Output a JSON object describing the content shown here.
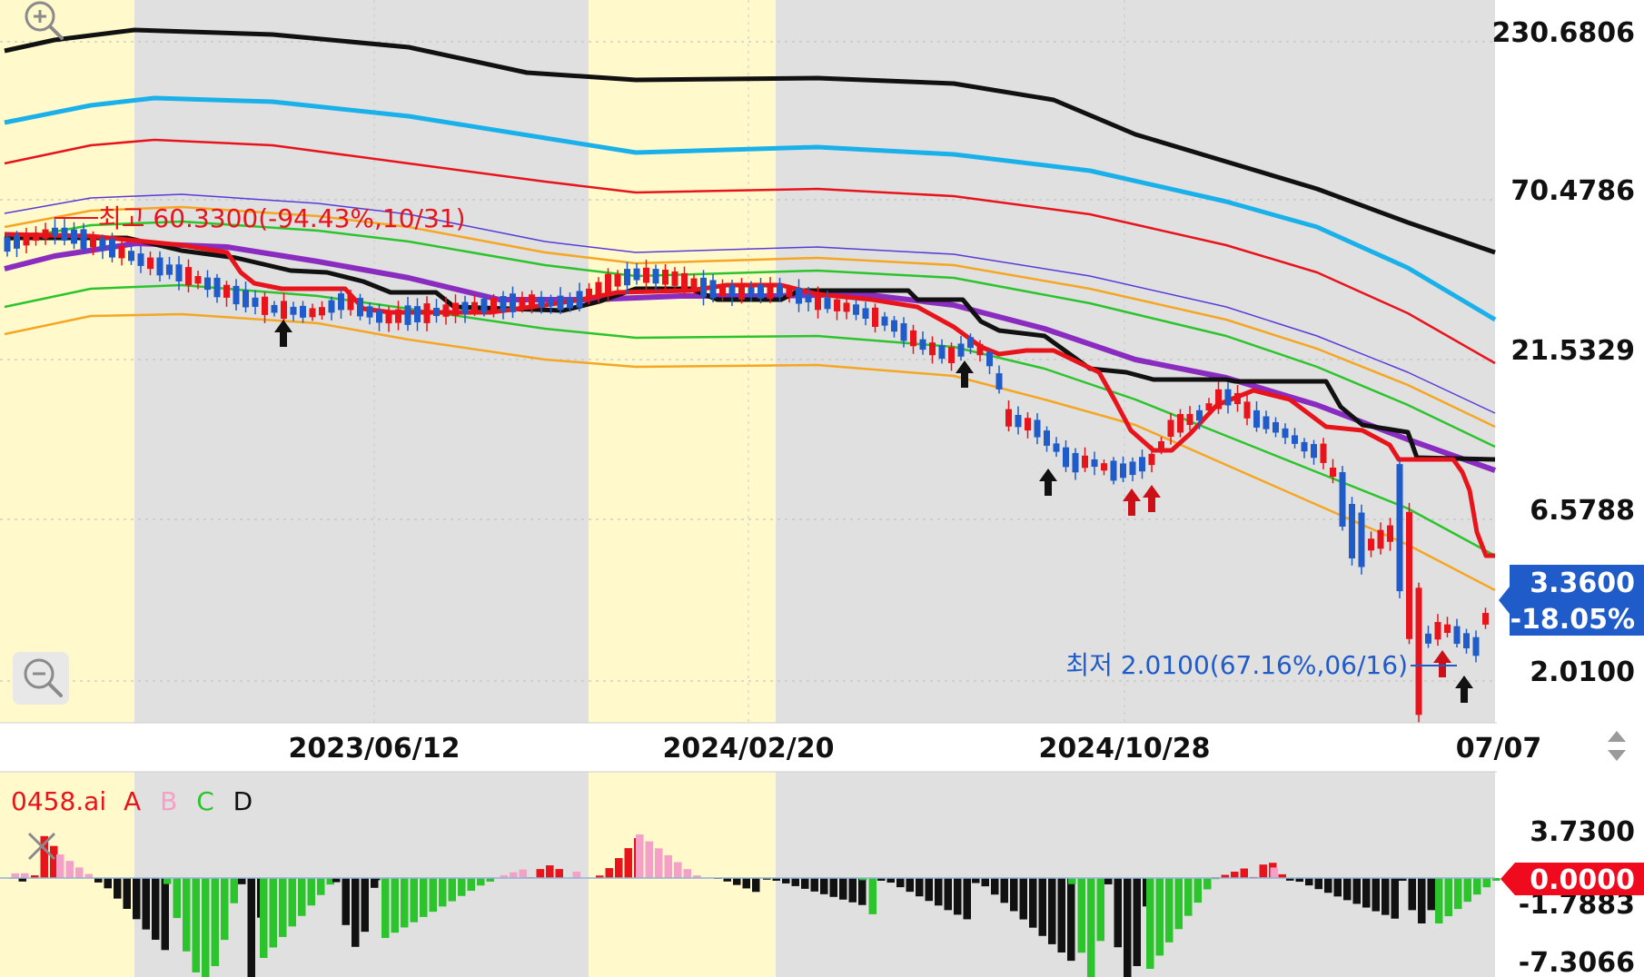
{
  "chart_data": [
    {
      "type": "candlestick",
      "scale": "log",
      "ylim": [
        1.7,
        300
      ],
      "y_ticks": [
        "230.6806",
        "70.4786",
        "21.5329",
        "6.5788",
        "2.0100"
      ],
      "x_ticks": [
        "2023/06/12",
        "2024/02/20",
        "2024/10/28",
        "07/07"
      ],
      "last_price": "3.3600",
      "last_change": "-18.05%",
      "annotations": {
        "high": "최고 60.3300(-94.43%,10/31)",
        "low": "최저 2.0100(67.16%,06/16)"
      },
      "colors": {
        "up": "#e8141c",
        "down": "#1f5cc9",
        "black_line": "#111111",
        "blue_line": "#1ab0ea",
        "red_line": "#e8141c",
        "purple_line": "#8a2cc0",
        "green_line": "#2cc42c",
        "orange_line": "#f5a623",
        "thin_purple": "#5a3ad8",
        "highlight": "#fff9cc",
        "shade": "#e0e0e0"
      }
    },
    {
      "type": "histogram",
      "label_prefix": "0458.ai",
      "legend": [
        {
          "name": "A",
          "color": "#e8141c"
        },
        {
          "name": "B",
          "color": "#f5a0c6"
        },
        {
          "name": "C",
          "color": "#2cc42c"
        },
        {
          "name": "D",
          "color": "#111111"
        }
      ],
      "y_ticks": [
        "3.7300",
        "0.0000",
        "-1.7883",
        "-7.3066"
      ],
      "current": "0.0000"
    }
  ],
  "icons": [
    "zoom-in-icon",
    "zoom-out-icon",
    "close-icon",
    "scroll-arrows-icon"
  ]
}
